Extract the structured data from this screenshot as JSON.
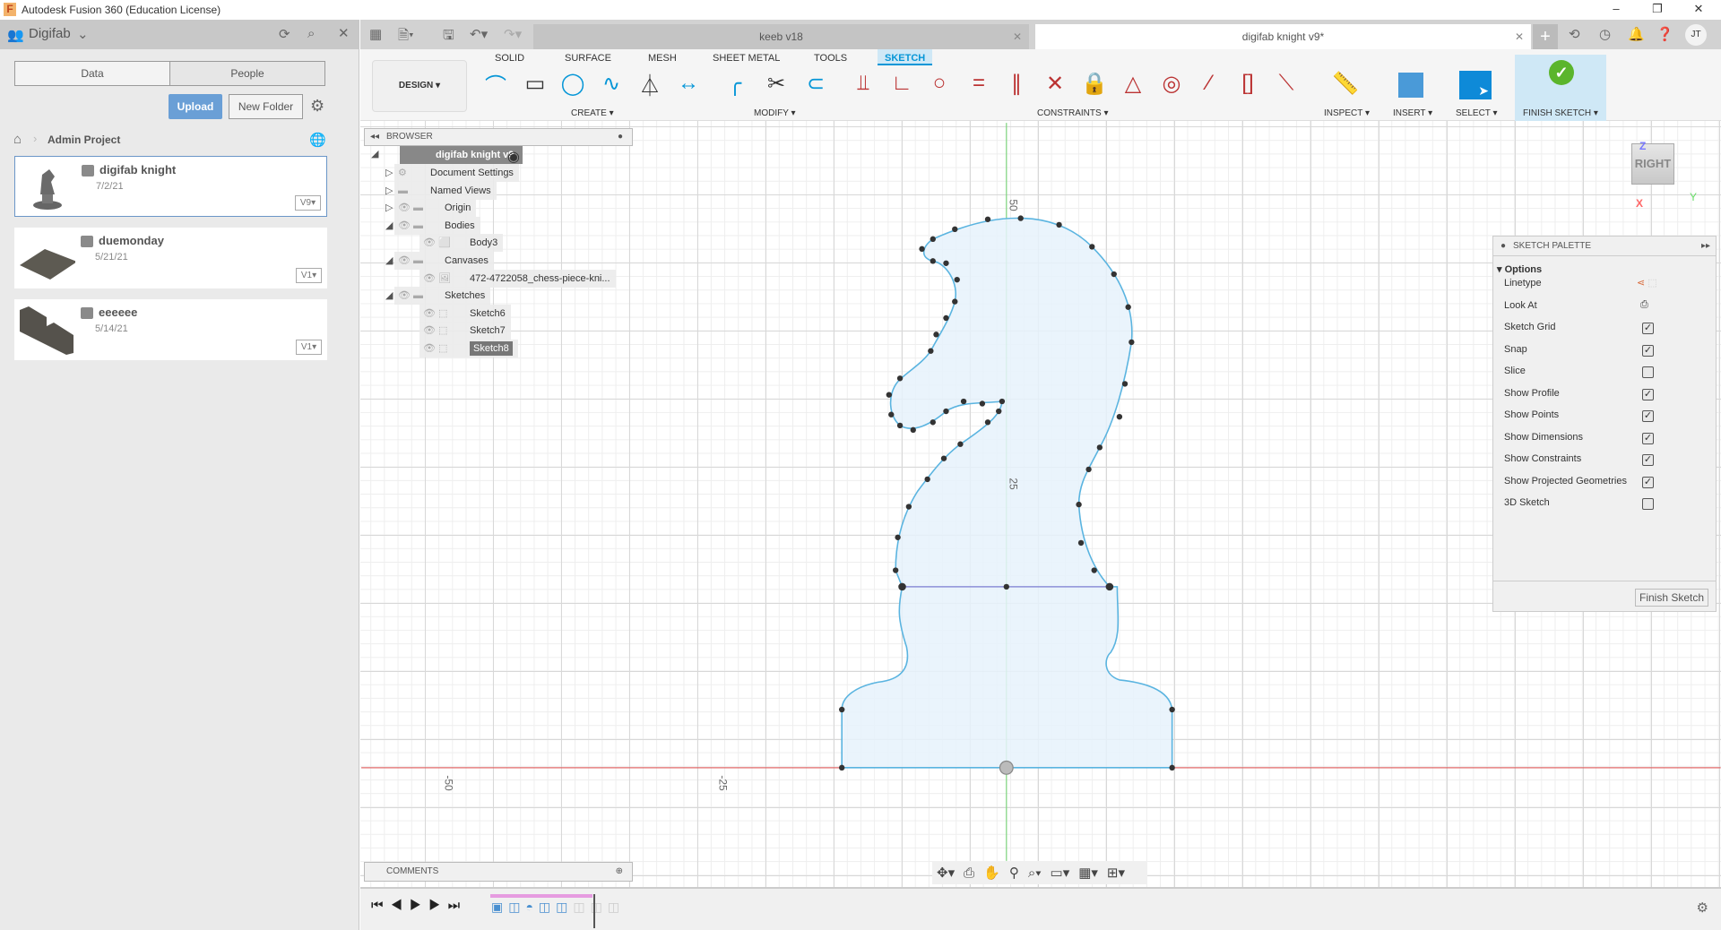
{
  "window": {
    "title": "Autodesk Fusion 360 (Education License)",
    "minimize": "–",
    "maximize": "❐",
    "close": "✕"
  },
  "left_panel": {
    "team": "Digifab",
    "tabs": [
      "Data",
      "People"
    ],
    "upload": "Upload",
    "new_folder": "New Folder",
    "breadcrumb": "Admin Project",
    "files": [
      {
        "name": "digifab knight",
        "date": "7/2/21",
        "version": "V9"
      },
      {
        "name": "duemonday",
        "date": "5/21/21",
        "version": "V1"
      },
      {
        "name": "eeeeee",
        "date": "5/14/21",
        "version": "V1"
      }
    ]
  },
  "doc_tabs": [
    {
      "label": "keeb v18",
      "active": false
    },
    {
      "label": "digifab knight v9*",
      "active": true
    }
  ],
  "user_initials": "JT",
  "toolbar": {
    "workspace": "DESIGN ▾",
    "tabs": [
      "SOLID",
      "SURFACE",
      "MESH",
      "SHEET METAL",
      "TOOLS",
      "SKETCH"
    ],
    "active_tab": "SKETCH",
    "groups": {
      "create": "CREATE ▾",
      "modify": "MODIFY ▾",
      "constraints": "CONSTRAINTS ▾",
      "inspect": "INSPECT ▾",
      "insert": "INSERT ▾",
      "select": "SELECT ▾",
      "finish": "FINISH SKETCH ▾"
    }
  },
  "browser": {
    "title": "BROWSER",
    "root": "digifab knight v9",
    "items": [
      "Document Settings",
      "Named Views",
      "Origin",
      "Bodies",
      "Body3",
      "Canvases",
      "472-4722058_chess-piece-kni...",
      "Sketches",
      "Sketch6",
      "Sketch7",
      "Sketch8"
    ]
  },
  "viewcube": {
    "face": "RIGHT",
    "z": "Z",
    "x": "X",
    "y": "Y"
  },
  "palette": {
    "title": "SKETCH PALETTE",
    "section": "Options",
    "finish": "Finish Sketch",
    "options": [
      {
        "label": "Linetype"
      },
      {
        "label": "Look At"
      },
      {
        "label": "Sketch Grid",
        "checked": true
      },
      {
        "label": "Snap",
        "checked": true
      },
      {
        "label": "Slice",
        "checked": false
      },
      {
        "label": "Show Profile",
        "checked": true
      },
      {
        "label": "Show Points",
        "checked": true
      },
      {
        "label": "Show Dimensions",
        "checked": true
      },
      {
        "label": "Show Constraints",
        "checked": true
      },
      {
        "label": "Show Projected Geometries",
        "checked": true
      },
      {
        "label": "3D Sketch",
        "checked": false
      }
    ]
  },
  "dimensions": {
    "v50": "50",
    "v25": "25",
    "hm50": "-50",
    "hm25": "-25"
  },
  "comments": "COMMENTS",
  "colors": {
    "accent": "#0696d7",
    "profile_fill": "#e6f2fb",
    "profile_stroke": "#5ab4e0",
    "finish_bg": "#cfe8f6"
  }
}
